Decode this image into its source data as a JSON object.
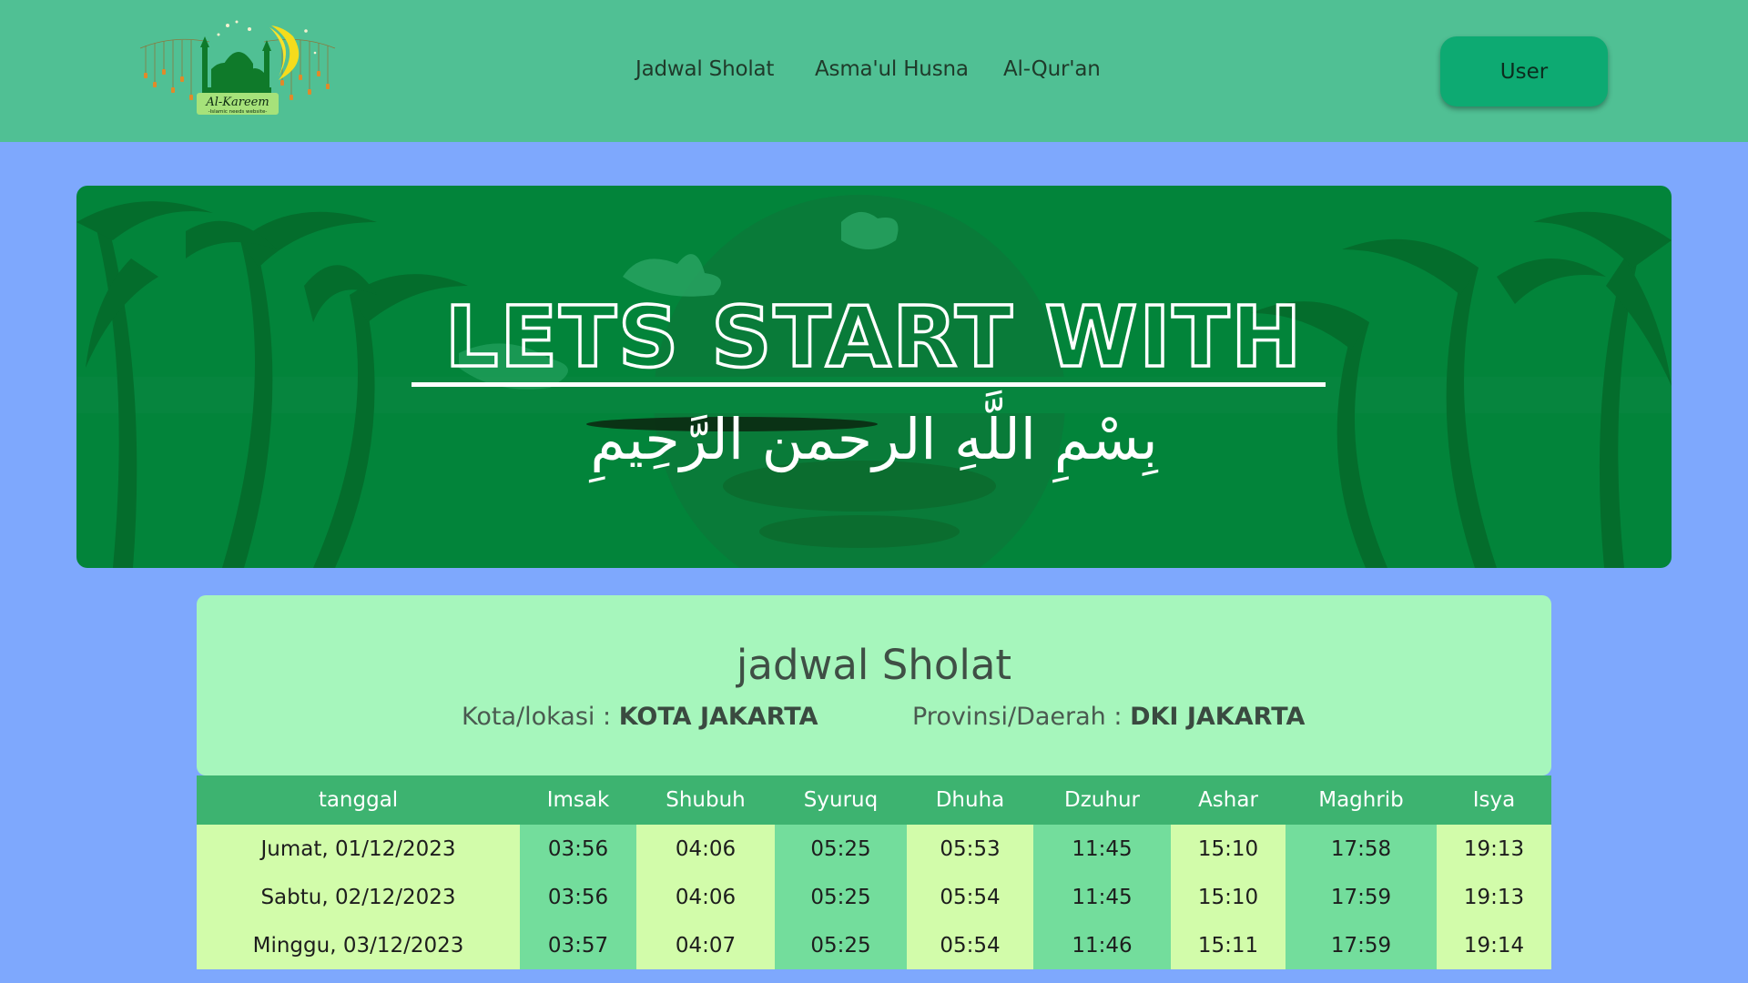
{
  "header": {
    "logo_title": "Al-Kareem",
    "logo_subtitle": "-Islamic needs website-",
    "nav": [
      "Jadwal Sholat",
      "Asma'ul Husna",
      "Al-Qur'an"
    ],
    "user_button": "User"
  },
  "banner": {
    "headline": "LETS START WITH",
    "arabic": "بِسْمِ اللَّهِ الرحمن الرَّحِيمِ"
  },
  "schedule": {
    "title": "jadwal Sholat",
    "city_label": "Kota/lokasi :",
    "city_value": "KOTA JAKARTA",
    "province_label": "Provinsi/Daerah :",
    "province_value": "DKI JAKARTA",
    "columns": [
      "tanggal",
      "Imsak",
      "Shubuh",
      "Syuruq",
      "Dhuha",
      "Dzuhur",
      "Ashar",
      "Maghrib",
      "Isya"
    ],
    "rows": [
      [
        "Jumat, 01/12/2023",
        "03:56",
        "04:06",
        "05:25",
        "05:53",
        "11:45",
        "15:10",
        "17:58",
        "19:13"
      ],
      [
        "Sabtu, 02/12/2023",
        "03:56",
        "04:06",
        "05:25",
        "05:54",
        "11:45",
        "15:10",
        "17:59",
        "19:13"
      ],
      [
        "Minggu, 03/12/2023",
        "03:57",
        "04:07",
        "05:25",
        "05:54",
        "11:46",
        "15:11",
        "17:59",
        "19:14"
      ]
    ]
  },
  "colors": {
    "header_bg": "#50c094",
    "page_bg": "#7ea8fd",
    "user_button": "#0daa72",
    "banner_bg": "#02843a",
    "card_bg": "#a6f6bc",
    "table_header": "#3db370",
    "cell_light": "#d2fcaa",
    "cell_dark": "#73dd9c"
  }
}
